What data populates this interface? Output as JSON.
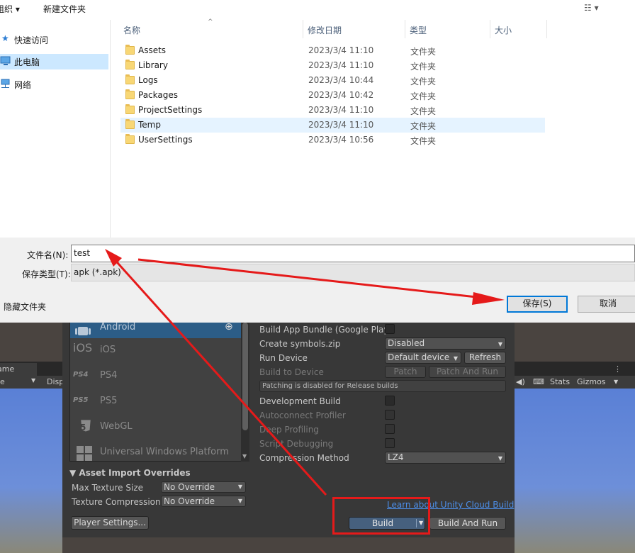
{
  "dialog": {
    "toolbar": {
      "organize": "组织 ▾",
      "new_folder": "新建文件夹",
      "view": "☷ ▾"
    },
    "nav": [
      {
        "label": "快速访问"
      },
      {
        "label": "此电脑"
      },
      {
        "label": "网络"
      }
    ],
    "columns": {
      "name": "名称",
      "modified": "修改日期",
      "type": "类型",
      "size": "大小"
    },
    "files": [
      {
        "name": "Assets",
        "modified": "2023/3/4 11:10",
        "type": "文件夹"
      },
      {
        "name": "Library",
        "modified": "2023/3/4 11:10",
        "type": "文件夹"
      },
      {
        "name": "Logs",
        "modified": "2023/3/4 10:44",
        "type": "文件夹"
      },
      {
        "name": "Packages",
        "modified": "2023/3/4 10:42",
        "type": "文件夹"
      },
      {
        "name": "ProjectSettings",
        "modified": "2023/3/4 11:10",
        "type": "文件夹"
      },
      {
        "name": "Temp",
        "modified": "2023/3/4 11:10",
        "type": "文件夹"
      },
      {
        "name": "UserSettings",
        "modified": "2023/3/4 10:56",
        "type": "文件夹"
      }
    ],
    "filename_label": "文件名(N):",
    "filename_value": "test",
    "filetype_label": "保存类型(T):",
    "filetype_value": "apk (*.apk)",
    "hide_folders": "隐藏文件夹",
    "save_label": "保存(S)",
    "cancel_label": "取消"
  },
  "unity": {
    "game_tab": "ame",
    "display_dropdown": "e",
    "display_label": "Disp",
    "toolbar_right": {
      "stats": "Stats",
      "gizmos": "Gizmos"
    },
    "platforms": [
      {
        "label": "Android",
        "icon": "android-icon"
      },
      {
        "label": "iOS",
        "icon": "ios-icon"
      },
      {
        "label": "PS4",
        "icon": "ps4-icon"
      },
      {
        "label": "PS5",
        "icon": "ps5-icon"
      },
      {
        "label": "WebGL",
        "icon": "html5-icon"
      },
      {
        "label": "Universal Windows Platform",
        "icon": "windows-icon"
      }
    ],
    "platform_icon_text": {
      "ios": "iOS",
      "ps4": "PS4",
      "ps5": "PS5",
      "webgl": "5"
    },
    "asset_overrides": {
      "header": "▼ Asset Import Overrides",
      "max_texture_size_label": "Max Texture Size",
      "max_texture_size_value": "No Override",
      "texture_compression_label": "Texture Compression",
      "texture_compression_value": "No Override"
    },
    "player_settings": "Player Settings...",
    "settings": {
      "build_app_bundle": "Build App Bundle (Google Play)",
      "create_symbols": "Create symbols.zip",
      "create_symbols_value": "Disabled",
      "run_device": "Run Device",
      "run_device_value": "Default device",
      "refresh": "Refresh",
      "build_to_device": "Build to Device",
      "patch": "Patch",
      "patch_and_run": "Patch And Run",
      "patch_info": "Patching is disabled for Release builds",
      "development_build": "Development Build",
      "autoconnect_profiler": "Autoconnect Profiler",
      "deep_profiling": "Deep Profiling",
      "script_debugging": "Script Debugging",
      "compression_method": "Compression Method",
      "compression_value": "LZ4"
    },
    "cloud_link": "Learn about Unity Cloud Build",
    "build": "Build",
    "build_and_run": "Build And Run"
  },
  "colors": {
    "annotation_red": "#e51a1a",
    "selection_blue": "#cce8ff",
    "unity_build_blue": "#46607e"
  }
}
